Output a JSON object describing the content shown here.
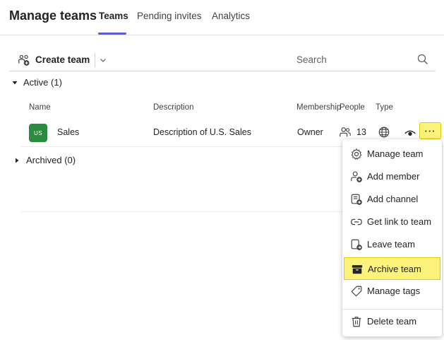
{
  "header": {
    "title": "Manage teams",
    "tabs": [
      {
        "label": "Teams"
      },
      {
        "label": "Pending invites"
      },
      {
        "label": "Analytics"
      }
    ]
  },
  "toolbar": {
    "create_label": "Create team",
    "search_placeholder": "Search"
  },
  "groups": {
    "active_label": "Active (1)",
    "archived_label": "Archived (0)"
  },
  "columns": {
    "name": "Name",
    "description": "Description",
    "membership": "Membership",
    "people": "People",
    "type": "Type"
  },
  "team": {
    "initials": "US",
    "name": "Sales",
    "description": "Description of U.S. Sales",
    "membership": "Owner",
    "people_count": "13",
    "more_label": "···"
  },
  "menu": {
    "items": [
      {
        "label": "Manage team",
        "icon": "gear-icon"
      },
      {
        "label": "Add member",
        "icon": "add-person-icon"
      },
      {
        "label": "Add channel",
        "icon": "add-channel-icon"
      },
      {
        "label": "Get link to team",
        "icon": "link-icon"
      },
      {
        "label": "Leave team",
        "icon": "leave-icon"
      },
      {
        "label": "Archive team",
        "icon": "archive-icon"
      },
      {
        "label": "Manage tags",
        "icon": "tag-icon"
      },
      {
        "label": "Delete team",
        "icon": "trash-icon"
      }
    ]
  },
  "colors": {
    "accent": "#5b5fc7",
    "avatar": "#2c8b3f",
    "highlight": "#fdf27a"
  }
}
